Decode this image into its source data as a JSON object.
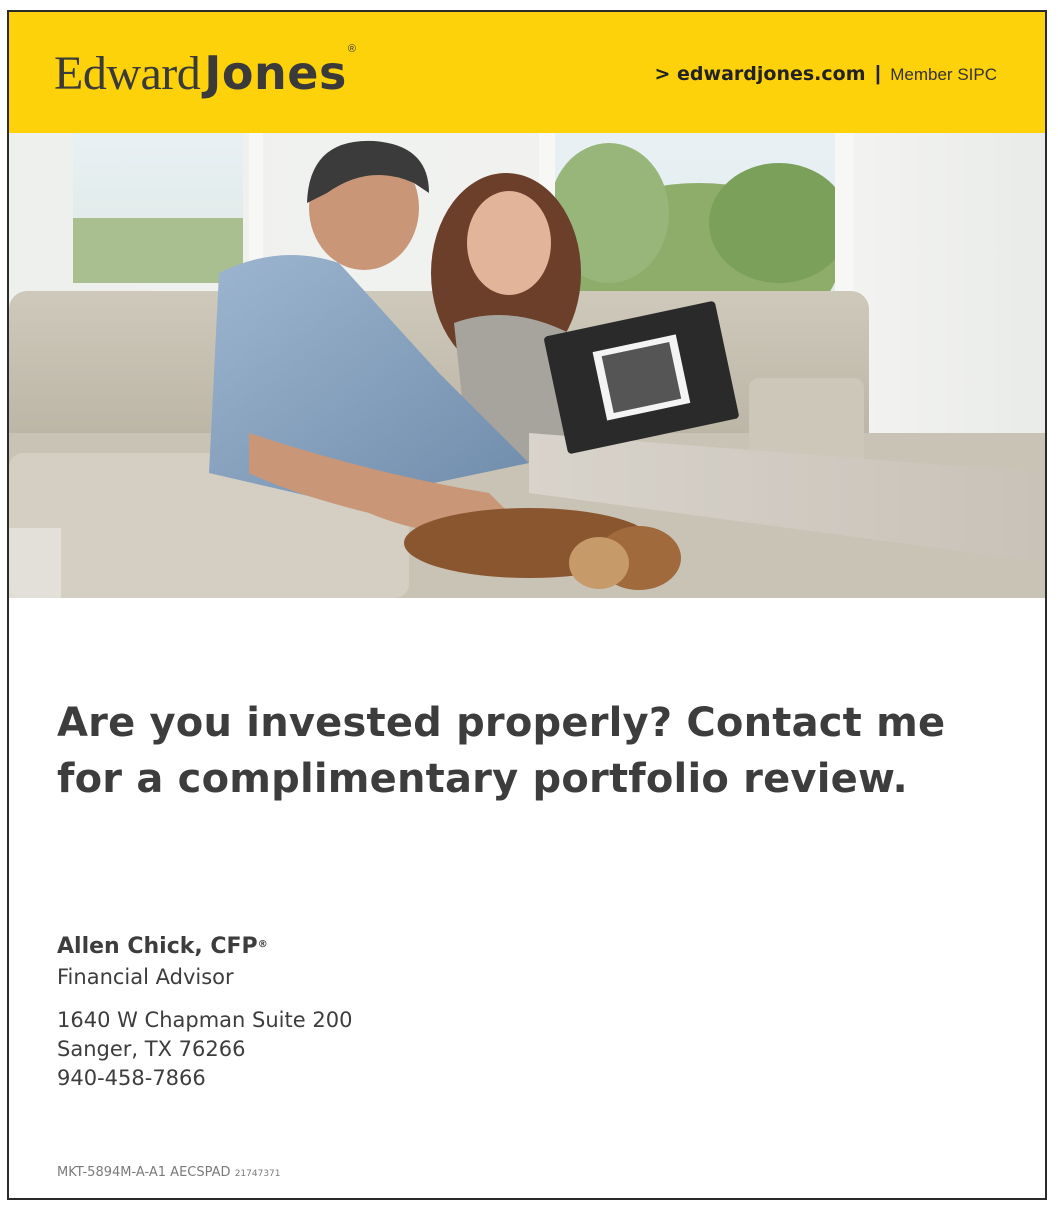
{
  "brand": {
    "logo_word1": "Edward",
    "logo_word2": "Jones",
    "logo_reg": "®",
    "header_color": "#fdd20a",
    "site_link": "> edwardjones.com",
    "separator": "|",
    "member": "Member SIPC"
  },
  "photo": {
    "icon": "couple-with-photo-album-and-dog-image"
  },
  "headline": {
    "line1": "Are you invested properly? Contact me",
    "line2": "for a complimentary portfolio review."
  },
  "advisor": {
    "name": "Allen Chick, CFP",
    "name_reg": "®",
    "title": "Financial Advisor",
    "address_line1": "1640 W Chapman Suite 200",
    "address_line2": "Sanger, TX 76266",
    "phone": "940-458-7866"
  },
  "footer": {
    "code": "MKT-5894M-A-A1 AECSPAD",
    "code_small": "21747371"
  },
  "text_color": "#3d3d3d"
}
